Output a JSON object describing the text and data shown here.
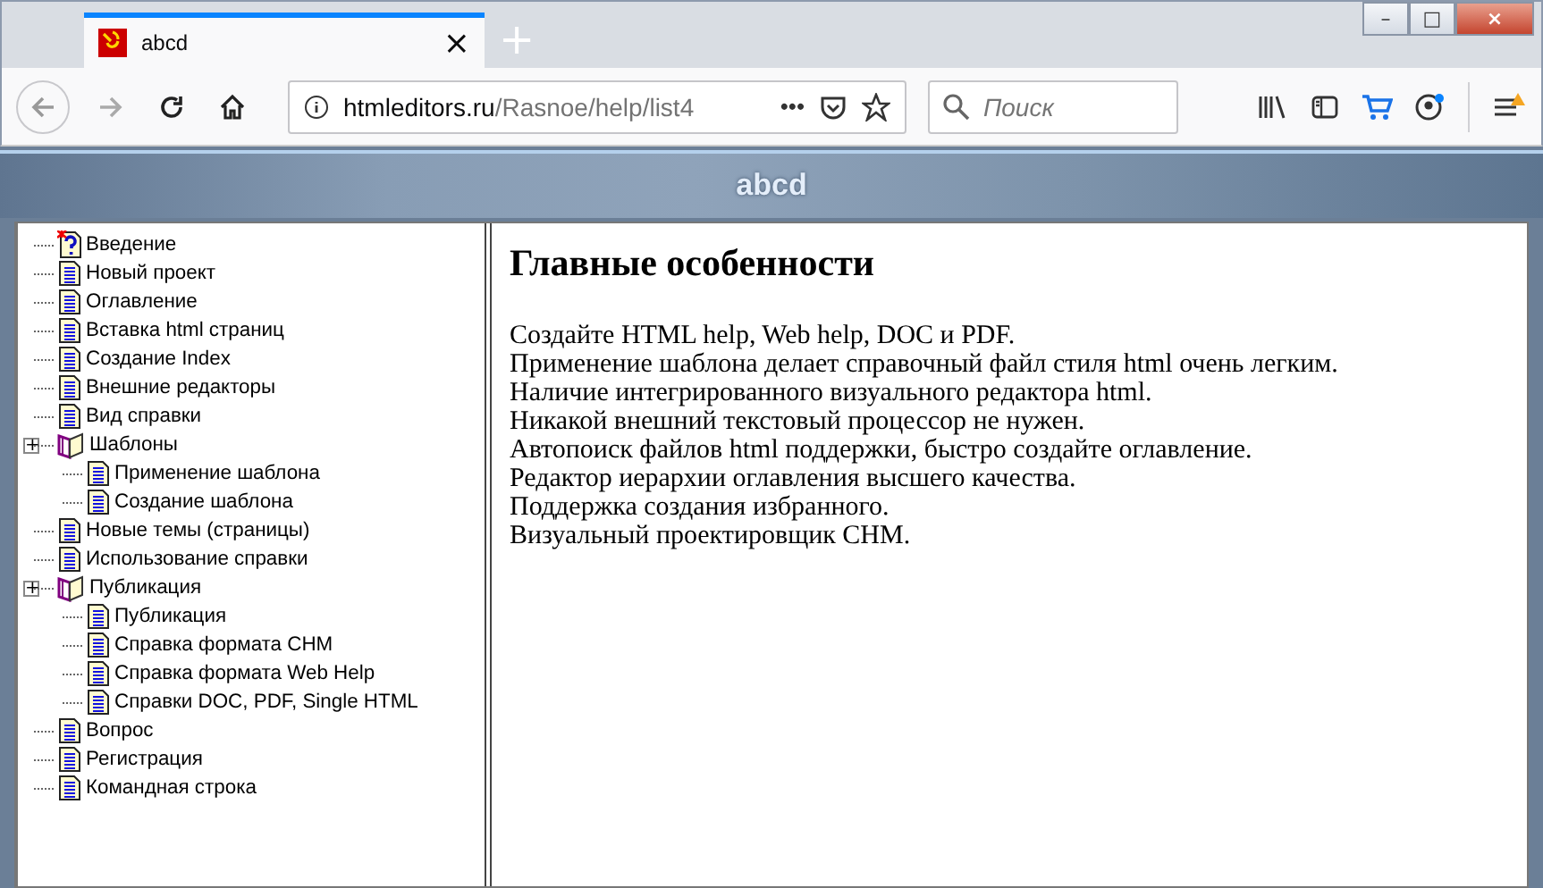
{
  "tab": {
    "title": "abcd",
    "close": "×",
    "new_tab": "+"
  },
  "window_controls": [
    "–",
    "□",
    "×"
  ],
  "address_bar": {
    "host": "htmleditors.ru",
    "path": "/Rasnoe/help/list4",
    "more": "•••"
  },
  "search": {
    "placeholder": "Поиск"
  },
  "banner": {
    "title": "abcd"
  },
  "toc": [
    {
      "label": "Введение",
      "kind": "intro"
    },
    {
      "label": "Новый проект",
      "kind": "page"
    },
    {
      "label": "Оглавление",
      "kind": "page"
    },
    {
      "label": "Вставка html страниц",
      "kind": "page"
    },
    {
      "label": "Создание Index",
      "kind": "page"
    },
    {
      "label": "Внешние редакторы",
      "kind": "page"
    },
    {
      "label": "Вид справки",
      "kind": "page"
    },
    {
      "label": "Шаблоны",
      "kind": "book",
      "toggle": "+",
      "children": [
        {
          "label": "Применение шаблона",
          "kind": "page"
        },
        {
          "label": "Создание шаблона",
          "kind": "page"
        }
      ]
    },
    {
      "label": "Новые темы (страницы)",
      "kind": "page"
    },
    {
      "label": "Использование справки",
      "kind": "page"
    },
    {
      "label": "Публикация",
      "kind": "book",
      "toggle": "+",
      "children": [
        {
          "label": "Публикация",
          "kind": "page"
        },
        {
          "label": "Справка формата CHM",
          "kind": "page"
        },
        {
          "label": "Справка формата Web Help",
          "kind": "page"
        },
        {
          "label": "Справки DOC, PDF, Single HTML",
          "kind": "page"
        }
      ]
    },
    {
      "label": "Вопрос",
      "kind": "page"
    },
    {
      "label": "Регистрация",
      "kind": "page"
    },
    {
      "label": "Командная строка",
      "kind": "page"
    }
  ],
  "content": {
    "heading": "Главные особенности",
    "lines": [
      "Создайте HTML help, Web help, DOC и PDF.",
      "Применение шаблона делает справочный файл стиля html очень легким.",
      "Наличие интегрированного визуального редактора html.",
      "Никакой внешний текстовый процессор не нужен.",
      "Автопоиск файлов html поддержки, быстро создайте оглавление.",
      "Редактор иерархии оглавления высшего качества.",
      "Поддержка создания избранного.",
      "Визуальный проектировщик CHM."
    ]
  }
}
